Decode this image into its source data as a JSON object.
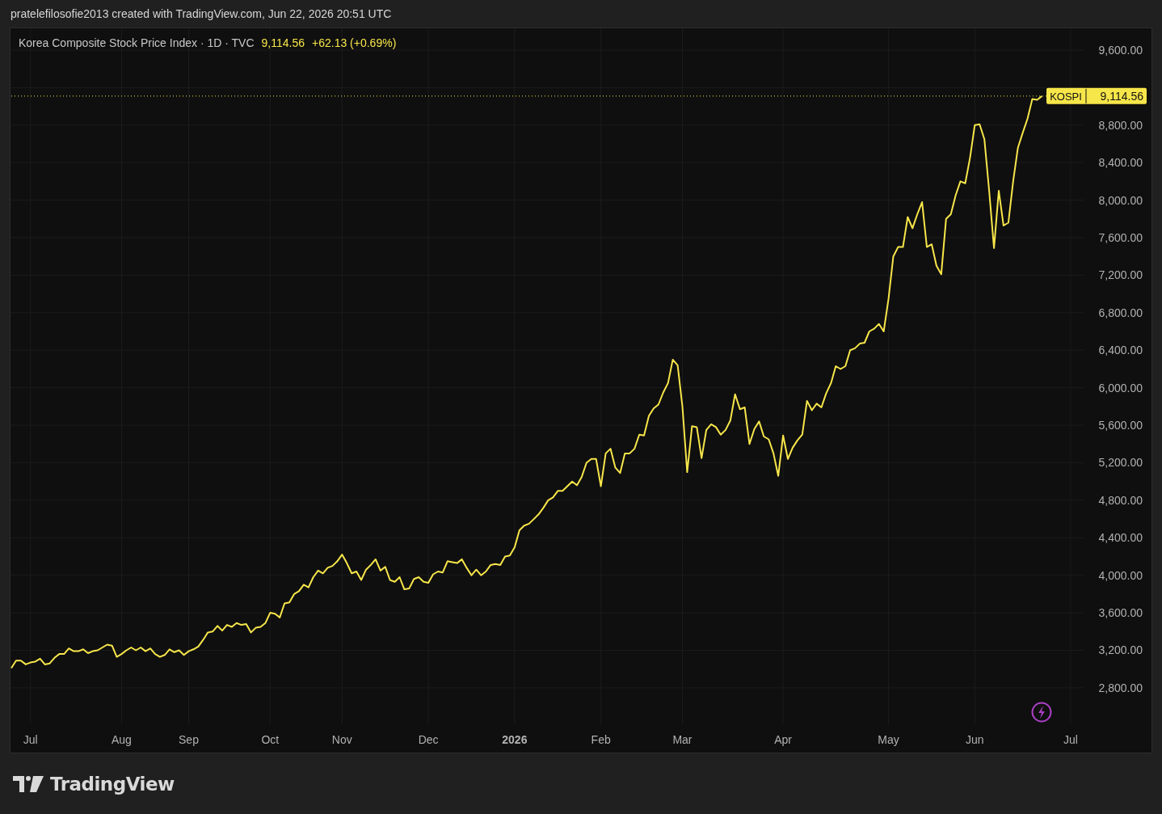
{
  "top_bar": {
    "caption": "pratelefilosofie2013 created with TradingView.com, Jun 22, 2026 20:51 UTC"
  },
  "legend": {
    "title": "Korea Composite Stock Price Index · 1D · TVC",
    "last": "9,114.56",
    "change": "+62.13 (+0.69%)"
  },
  "price_tag": {
    "value": "9,114.56"
  },
  "chart_data": {
    "type": "line",
    "grid": true,
    "ylim": [
      2411,
      9833
    ],
    "ref_lines": [
      {
        "axis": "y",
        "value": 9110
      }
    ],
    "categories": [
      null,
      null,
      null,
      null,
      "Jul",
      null,
      null,
      null,
      null,
      null,
      null,
      null,
      null,
      null,
      null,
      null,
      null,
      null,
      null,
      null,
      null,
      null,
      null,
      "Aug",
      null,
      null,
      null,
      null,
      null,
      null,
      null,
      null,
      null,
      null,
      null,
      null,
      null,
      "Sep",
      null,
      null,
      null,
      null,
      null,
      null,
      null,
      null,
      null,
      null,
      null,
      null,
      null,
      null,
      null,
      null,
      "Oct",
      null,
      null,
      null,
      null,
      null,
      null,
      null,
      null,
      null,
      null,
      null,
      null,
      null,
      null,
      "Nov",
      null,
      null,
      null,
      null,
      null,
      null,
      null,
      null,
      null,
      null,
      null,
      null,
      null,
      null,
      null,
      null,
      null,
      "Dec",
      null,
      null,
      null,
      null,
      null,
      null,
      null,
      null,
      null,
      null,
      null,
      null,
      null,
      null,
      null,
      null,
      null,
      "2026",
      null,
      null,
      null,
      null,
      null,
      null,
      null,
      null,
      null,
      null,
      null,
      null,
      null,
      null,
      null,
      null,
      null,
      "Feb",
      null,
      null,
      null,
      null,
      null,
      null,
      null,
      null,
      null,
      null,
      null,
      null,
      null,
      null,
      null,
      null,
      "Mar",
      null,
      null,
      null,
      null,
      null,
      null,
      null,
      null,
      null,
      null,
      null,
      null,
      null,
      null,
      null,
      null,
      null,
      null,
      null,
      null,
      "Apr",
      null,
      null,
      null,
      null,
      null,
      null,
      null,
      null,
      null,
      null,
      null,
      null,
      null,
      null,
      null,
      null,
      null,
      null,
      null,
      null,
      null,
      "May",
      null,
      null,
      null,
      null,
      null,
      null,
      null,
      null,
      null,
      null,
      null,
      null,
      null,
      null,
      null,
      null,
      null,
      "Jun",
      null,
      null,
      null,
      null,
      null,
      null,
      null,
      null,
      null,
      null,
      null,
      null,
      null,
      null,
      null,
      null,
      null,
      null,
      null,
      "Jul"
    ],
    "yticks": [
      {
        "value": 2800,
        "label": "2,800.00"
      },
      {
        "value": 3200,
        "label": "3,200.00"
      },
      {
        "value": 3600,
        "label": "3,600.00"
      },
      {
        "value": 4000,
        "label": "4,000.00"
      },
      {
        "value": 4400,
        "label": "4,400.00"
      },
      {
        "value": 4800,
        "label": "4,800.00"
      },
      {
        "value": 5200,
        "label": "5,200.00"
      },
      {
        "value": 5600,
        "label": "5,600.00"
      },
      {
        "value": 6000,
        "label": "6,000.00"
      },
      {
        "value": 6400,
        "label": "6,400.00"
      },
      {
        "value": 6800,
        "label": "6,800.00"
      },
      {
        "value": 7200,
        "label": "7,200.00"
      },
      {
        "value": 7600,
        "label": "7,600.00"
      },
      {
        "value": 8000,
        "label": "8,000.00"
      },
      {
        "value": 8400,
        "label": "8,400.00"
      },
      {
        "value": 8800,
        "label": "8,800.00"
      },
      {
        "value": 9600,
        "label": "9,600.00"
      }
    ],
    "series": [
      {
        "name": "KOSPI",
        "color": "#f7e64a",
        "values": [
          3010,
          3090,
          3090,
          3050,
          3070,
          3080,
          3110,
          3050,
          3060,
          3120,
          3160,
          3160,
          3220,
          3190,
          3190,
          3210,
          3170,
          3190,
          3200,
          3230,
          3260,
          3250,
          3130,
          3160,
          3200,
          3230,
          3200,
          3230,
          3190,
          3220,
          3160,
          3130,
          3150,
          3210,
          3180,
          3200,
          3150,
          3190,
          3210,
          3240,
          3310,
          3390,
          3400,
          3460,
          3410,
          3470,
          3450,
          3490,
          3470,
          3480,
          3390,
          3440,
          3450,
          3490,
          3600,
          3590,
          3550,
          3700,
          3710,
          3800,
          3830,
          3900,
          3870,
          3980,
          4050,
          4020,
          4080,
          4100,
          4150,
          4220,
          4130,
          4020,
          4040,
          3950,
          4060,
          4110,
          4170,
          4050,
          4090,
          3950,
          3930,
          3980,
          3850,
          3860,
          3960,
          3980,
          3930,
          3920,
          4010,
          4040,
          4030,
          4150,
          4140,
          4130,
          4170,
          4080,
          4000,
          4060,
          4000,
          4040,
          4110,
          4120,
          4110,
          4200,
          4210,
          4300,
          4480,
          4530,
          4550,
          4600,
          4650,
          4720,
          4800,
          4830,
          4900,
          4900,
          4950,
          5000,
          4960,
          5050,
          5200,
          5240,
          5240,
          4950,
          5300,
          5350,
          5150,
          5090,
          5300,
          5300,
          5350,
          5500,
          5490,
          5700,
          5780,
          5820,
          5950,
          6050,
          6300,
          6240,
          5800,
          5100,
          5590,
          5580,
          5250,
          5550,
          5610,
          5580,
          5500,
          5550,
          5650,
          5930,
          5770,
          5790,
          5400,
          5560,
          5640,
          5480,
          5450,
          5300,
          5060,
          5490,
          5240,
          5360,
          5440,
          5500,
          5860,
          5760,
          5830,
          5790,
          5940,
          6050,
          6230,
          6200,
          6230,
          6400,
          6420,
          6470,
          6480,
          6600,
          6630,
          6680,
          6600,
          6950,
          7400,
          7500,
          7500,
          7820,
          7700,
          7850,
          7980,
          7500,
          7530,
          7300,
          7210,
          7800,
          7850,
          8050,
          8200,
          8180,
          8450,
          8800,
          8810,
          8650,
          8100,
          7490,
          8100,
          7730,
          7760,
          8200,
          8560,
          8720,
          8870,
          9080,
          9070,
          9110,
          null,
          null,
          null,
          null,
          null,
          null
        ]
      }
    ]
  },
  "footer": {
    "logo_text": "TradingView"
  }
}
